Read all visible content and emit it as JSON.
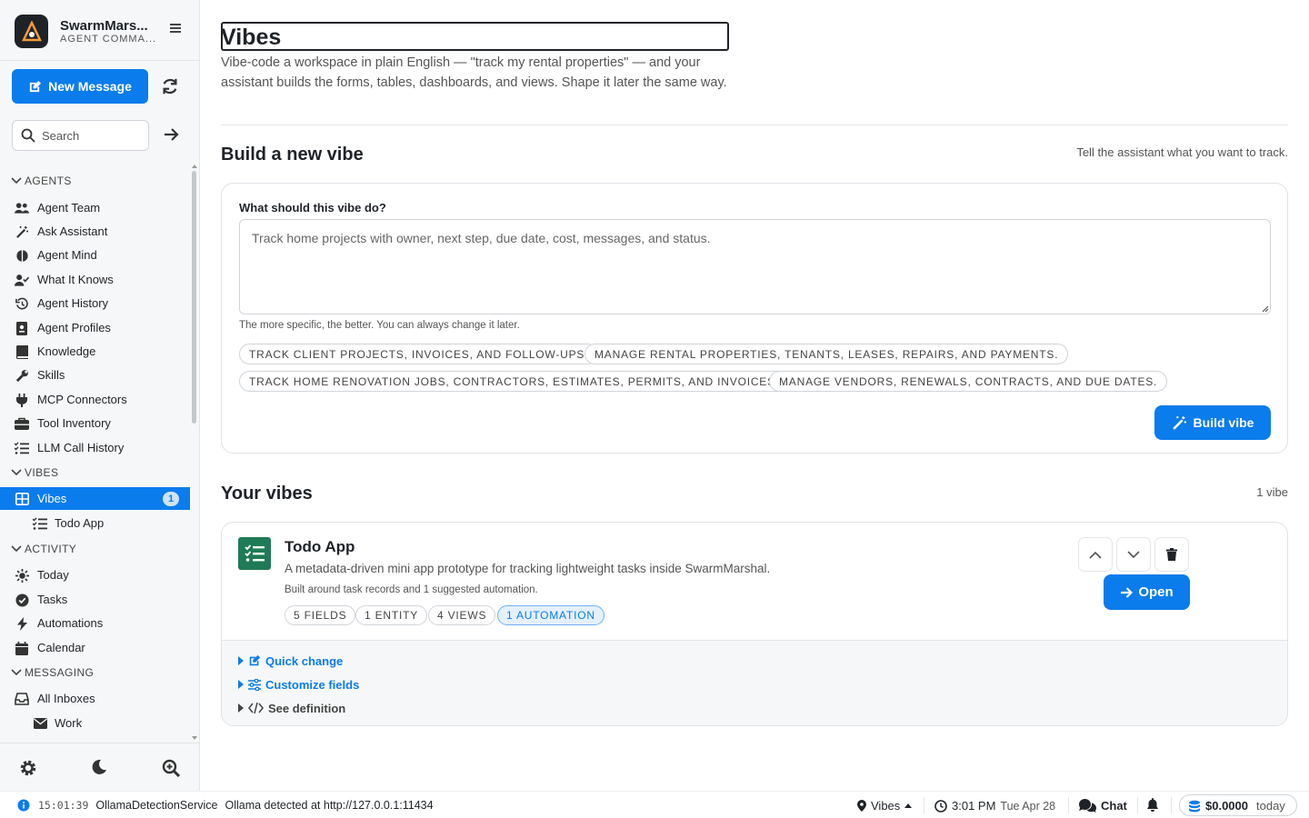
{
  "sidebar": {
    "brand_name": "SwarmMars...",
    "brand_sub": "AGENT COMMA...",
    "new_message": "New Message",
    "search_placeholder": "Search",
    "sections": {
      "agents": "AGENTS",
      "vibes": "VIBES",
      "activity": "ACTIVITY",
      "messaging": "MESSAGING"
    },
    "items": {
      "agent_team": "Agent Team",
      "ask_assistant": "Ask Assistant",
      "agent_mind": "Agent Mind",
      "what_it_knows": "What It Knows",
      "agent_history": "Agent History",
      "agent_profiles": "Agent Profiles",
      "knowledge": "Knowledge",
      "skills": "Skills",
      "mcp_connectors": "MCP Connectors",
      "tool_inventory": "Tool Inventory",
      "llm_call_history": "LLM Call History",
      "vibes": "Vibes",
      "vibes_badge": "1",
      "todo_app": "Todo App",
      "today": "Today",
      "tasks": "Tasks",
      "automations": "Automations",
      "calendar": "Calendar",
      "all_inboxes": "All Inboxes",
      "work": "Work"
    }
  },
  "main": {
    "title": "Vibes",
    "description": "Vibe-code a workspace in plain English — \"track my rental properties\" — and your assistant builds the forms, tables, dashboards, and views. Shape it later the same way.",
    "build": {
      "heading": "Build a new vibe",
      "hint": "Tell the assistant what you want to track.",
      "field_label": "What should this vibe do?",
      "placeholder": "Track home projects with owner, next step, due date, cost, messages, and status.",
      "help": "The more specific, the better. You can always change it later.",
      "suggestions": [
        "TRACK CLIENT PROJECTS, INVOICES, AND FOLLOW-UPS.",
        "MANAGE RENTAL PROPERTIES, TENANTS, LEASES, REPAIRS, AND PAYMENTS.",
        "TRACK HOME RENOVATION JOBS, CONTRACTORS, ESTIMATES, PERMITS, AND INVOICES.",
        "MANAGE VENDORS, RENEWALS, CONTRACTS, AND DUE DATES."
      ],
      "button": "Build vibe"
    },
    "your_vibes": {
      "heading": "Your vibes",
      "count": "1 vibe",
      "item": {
        "name": "Todo App",
        "description": "A metadata-driven mini app prototype for tracking lightweight tasks inside SwarmMarshal.",
        "meta": "Built around task records and 1 suggested automation.",
        "tags": [
          "5 FIELDS",
          "1 ENTITY",
          "4 VIEWS",
          "1 AUTOMATION"
        ],
        "open": "Open",
        "quick_change": "Quick change",
        "customize_fields": "Customize fields",
        "see_definition": "See definition"
      }
    }
  },
  "statusbar": {
    "time": "15:01:39",
    "service": "OllamaDetectionService",
    "message": "Ollama detected at http://127.0.0.1:11434",
    "location": "Vibes",
    "clock": "3:01 PM",
    "date": "Tue Apr 28",
    "chat": "Chat",
    "cost": "$0.0000",
    "cost_period": "today"
  },
  "colors": {
    "accent": "#0b7cec",
    "vibe_icon": "#1f7a57"
  }
}
